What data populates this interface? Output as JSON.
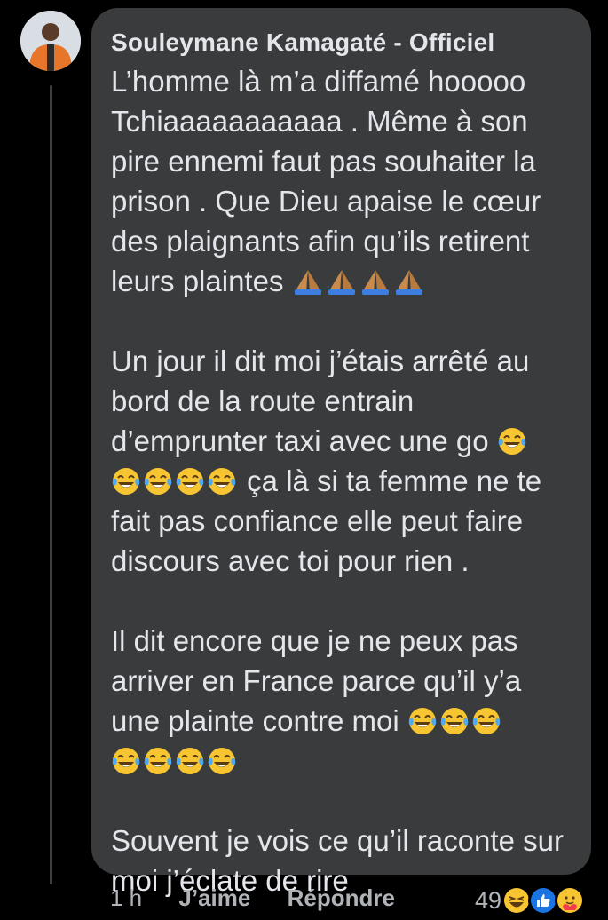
{
  "comment": {
    "author": "Souleymane Kamagaté - Officiel",
    "paragraphs": {
      "p1_line1": "L’homme là m’a diffamé hooooo Tchiaaaaaaaaaaa . Même à son pire ennemi faut pas souhaiter la prison . Que Dieu apaise le cœur des plaignants afin qu’ils retirent leurs plaintes",
      "p2_part1": "Un jour il dit moi j’étais arrêté au bord de la route entrain d’emprunter taxi avec une go",
      "p2_part2": "ça là si ta femme ne te fait pas confiance elle peut faire discours avec toi pour rien .",
      "p3": "Il dit encore que je ne peux pas arriver en France parce qu’il y’a une plainte contre moi",
      "p4": "Souvent je vois ce qu’il raconte sur moi j’éclate de rire"
    },
    "emojis": {
      "pray": "folded-hands-icon",
      "laugh": "face-with-tears-of-joy-icon"
    }
  },
  "actions": {
    "time": "1 h",
    "like": "J’aime",
    "reply": "Répondre"
  },
  "reactions": {
    "count": "49",
    "icons": [
      "haha-reaction-icon",
      "like-reaction-icon",
      "care-reaction-icon"
    ]
  },
  "colors": {
    "background": "#000000",
    "bubble": "#3a3b3c",
    "text": "#e4e6eb",
    "secondary": "#b0b3b8"
  }
}
